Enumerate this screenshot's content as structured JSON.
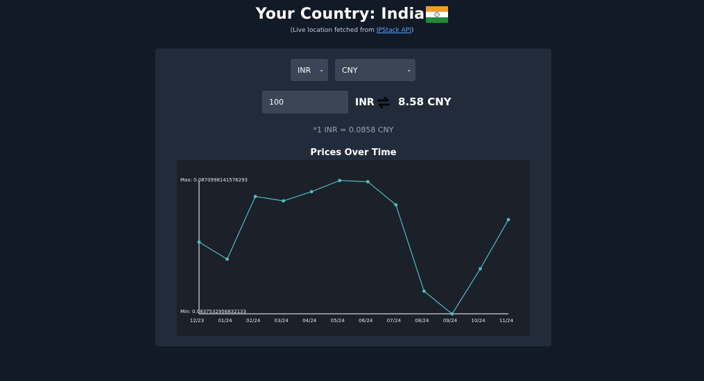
{
  "header": {
    "title": "Your Country: India",
    "subtitle_prefix": "(Live location fetched from ",
    "subtitle_link": "IPStack API",
    "subtitle_suffix": ")"
  },
  "converter": {
    "from_currency": "INR",
    "to_currency": "CNY",
    "amount": "100",
    "from_code_label": "INR",
    "result": "8.58 CNY",
    "rate_text": "*1 INR = 0.0858 CNY"
  },
  "chart_title": "Prices Over Time",
  "colors": {
    "background": "#121a28",
    "card": "#212b3a",
    "chart_bg": "#1b2029",
    "line": "#4dc0c0",
    "link": "#5aa2ff"
  },
  "chart_data": {
    "type": "line",
    "title": "Prices Over Time",
    "categories": [
      "12/23",
      "01/24",
      "02/24",
      "03/24",
      "04/24",
      "05/24",
      "06/24",
      "07/24",
      "08/24",
      "09/24",
      "10/24",
      "11/24"
    ],
    "values": [
      0.08555,
      0.08512,
      0.08669,
      0.08658,
      0.08681,
      0.08709,
      0.08706,
      0.08648,
      0.08432,
      0.08375,
      0.08488,
      0.08611
    ],
    "max_label": "Max: 0.0870998141576293",
    "min_label": "Min: 0.0837532956832133",
    "ylim": [
      0.0837532956832133,
      0.0870998141576293
    ],
    "grid": false,
    "legend": "none"
  }
}
